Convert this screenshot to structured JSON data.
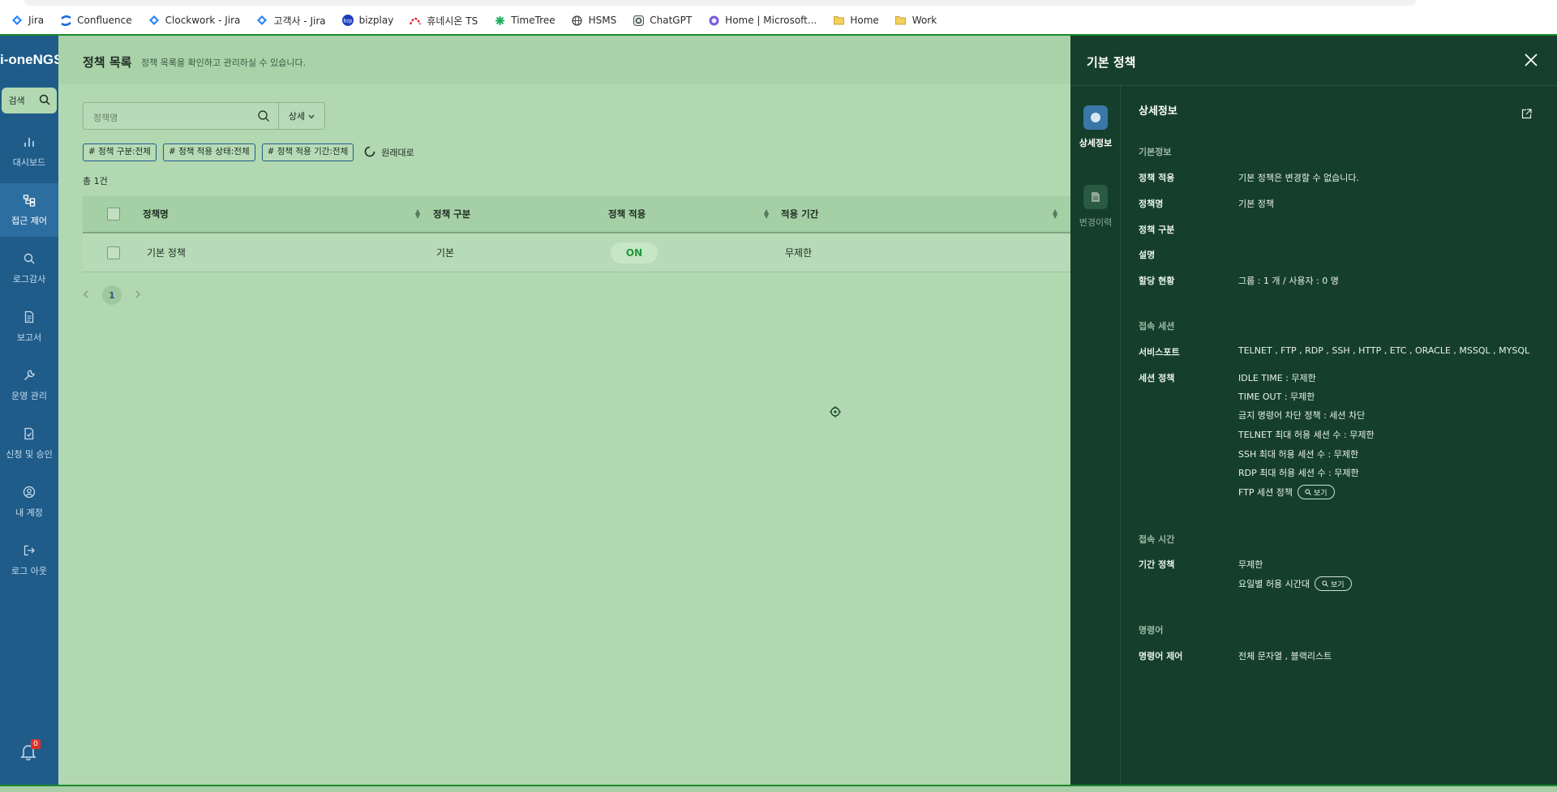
{
  "bookmarks": [
    {
      "icon": "jira-icon",
      "label": "Jira"
    },
    {
      "icon": "confluence-icon",
      "label": "Confluence"
    },
    {
      "icon": "jira-icon",
      "label": "Clockwork - Jira"
    },
    {
      "icon": "jira-icon",
      "label": "고객사 - Jira"
    },
    {
      "icon": "bizplay-icon",
      "label": "bizplay"
    },
    {
      "icon": "company-icon",
      "label": "휴네시온 TS"
    },
    {
      "icon": "timetree-icon",
      "label": "TimeTree"
    },
    {
      "icon": "globe-icon",
      "label": "HSMS"
    },
    {
      "icon": "chatgpt-icon",
      "label": "ChatGPT"
    },
    {
      "icon": "microsoft-icon",
      "label": "Home | Microsoft..."
    },
    {
      "icon": "folder-icon",
      "label": "Home"
    },
    {
      "icon": "folder-icon",
      "label": "Work"
    }
  ],
  "sidebar": {
    "brand": "i-oneNGS",
    "search_label": "검색",
    "items": [
      {
        "label": "대시보드",
        "icon": "bar-chart-icon"
      },
      {
        "label": "접근 제어",
        "icon": "network-icon"
      },
      {
        "label": "로그감사",
        "icon": "magnifier-icon"
      },
      {
        "label": "보고서",
        "icon": "document-icon"
      },
      {
        "label": "운영 관리",
        "icon": "wrench-icon"
      },
      {
        "label": "신청 및 승인",
        "icon": "approval-icon"
      },
      {
        "label": "내 계정",
        "icon": "user-icon"
      },
      {
        "label": "로그 아웃",
        "icon": "logout-icon"
      }
    ],
    "notification_count": "0"
  },
  "main": {
    "title": "정책 목록",
    "subtitle": "정책 목록을 확인하고 관리하실 수 있습니다.",
    "search_placeholder": "정책명",
    "detail_button": "상세",
    "chips": [
      "# 정책 구분:전체",
      "# 정책 적용 상태:전체",
      "# 정책 적용 기간:전체"
    ],
    "reset_label": "원래대로",
    "total": "총 1건",
    "columns": [
      "정책명",
      "정책 구분",
      "정책 적용",
      "적용 기간"
    ],
    "rows": [
      {
        "name": "기본 정책",
        "type": "기본",
        "status": "ON",
        "period": "무제한"
      }
    ],
    "pagination": {
      "current": "1"
    }
  },
  "panel": {
    "title": "기본 정책",
    "tabs": [
      {
        "label": "상세정보",
        "icon": "info-icon",
        "active": true
      },
      {
        "label": "변경이력",
        "icon": "history-icon",
        "active": false
      }
    ],
    "section_title": "상세정보",
    "basic": {
      "heading": "기본정보",
      "fields": [
        {
          "label": "정책 적용",
          "value": "기본 정책은 변경할 수 없습니다."
        },
        {
          "label": "정책명",
          "value": "기본 정책"
        },
        {
          "label": "정책 구분",
          "value": ""
        },
        {
          "label": "설명",
          "value": ""
        },
        {
          "label": "할당 현황",
          "value": "그룹 : 1 개 / 사용자 : 0 명"
        }
      ]
    },
    "session": {
      "heading": "접속 세션",
      "service_label": "서비스포트",
      "service_value": "TELNET , FTP , RDP , SSH , HTTP , ETC , ORACLE , MSSQL , MYSQL",
      "policy_label": "세션 정책",
      "policy_lines": [
        "IDLE TIME : 무제한",
        "TIME OUT : 무제한",
        "금지 명령어 차단 정책 : 세션 차단",
        "TELNET 최대 허용 세션 수 : 무제한",
        "SSH 최대 허용 세션 수 : 무제한",
        "RDP 최대 허용 세션 수 : 무제한"
      ],
      "ftp_label": "FTP 세션 정책",
      "view_label": "보기"
    },
    "time": {
      "heading": "접속 시간",
      "period_label": "기간 정책",
      "period_value": "무제한",
      "weekday_value": "요일별 허용 시간대",
      "view_label": "보기"
    },
    "command": {
      "heading": "명령어",
      "label": "명령어 제어",
      "value": "전체 문자열 , 블랙리스트"
    }
  },
  "colors": {
    "sidebar": "#1f5c8a",
    "panel": "#153f2c",
    "overlay_green": "#b1d8b0",
    "accent_on": "#1e9a3a"
  }
}
